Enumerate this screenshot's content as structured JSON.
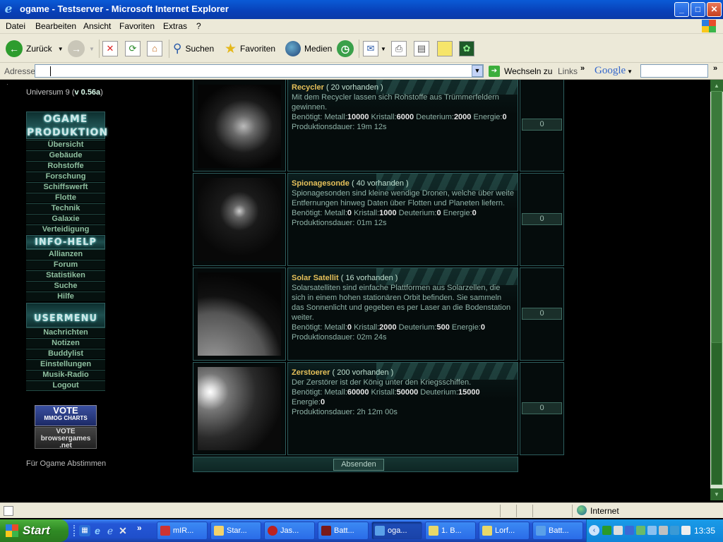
{
  "window": {
    "title": "ogame - Testserver - Microsoft Internet Explorer",
    "minimize": "_",
    "maximize": "□",
    "close": "✕"
  },
  "menu": [
    "Datei",
    "Bearbeiten",
    "Ansicht",
    "Favoriten",
    "Extras",
    "?"
  ],
  "toolbar": {
    "back_label": "Zurück",
    "search_label": "Suchen",
    "favorites_label": "Favoriten",
    "media_label": "Medien"
  },
  "address": {
    "label": "Adresse",
    "value": "",
    "go_label": "Wechseln zu",
    "links_label": "Links",
    "google_label": "Google"
  },
  "nav": {
    "universe_prefix": "Universum 9 (",
    "version": "v 0.56a",
    "universe_suffix": ")",
    "header_production": "OGAME PRODUKTION",
    "production_items": [
      "Übersicht",
      "Gebäude",
      "Rohstoffe",
      "Forschung",
      "Schiffswerft",
      "Flotte",
      "Technik",
      "Galaxie",
      "Verteidigung"
    ],
    "header_info": "INFO-HELP",
    "info_items": [
      "Allianzen",
      "Forum",
      "Statistiken",
      "Suche",
      "Hilfe"
    ],
    "header_user": "USERMENU",
    "user_items": [
      "Nachrichten",
      "Notizen",
      "Buddylist",
      "Einstellungen",
      "Musik-Radio",
      "Logout"
    ],
    "vote1_title": "VOTE",
    "vote1_sub": "MMOG CHARTS",
    "vote2_title": "VOTE",
    "vote2_sub1": "browsergames",
    "vote2_sub2": ".net",
    "vote_caption": "Für Ogame Abstimmen"
  },
  "ships": [
    {
      "name": "Recycler",
      "count": "( 20 vorhanden )",
      "description": "Mit dem Recycler lassen sich Rohstoffe aus Trümmerfeldern gewinnen.",
      "cost_prefix": "Benötigt: Metall:",
      "metal": "10000",
      "crystal_label": "Kristall:",
      "crystal": "6000",
      "deut_label": "Deuterium:",
      "deuterium": "2000",
      "energy_label": "Energie:",
      "energy": "0",
      "time": "Produktionsdauer: 19m 12s",
      "quantity": "0"
    },
    {
      "name": "Spionagesonde",
      "count": "( 40 vorhanden )",
      "description": "Spionagesonden sind kleine wendige Dronen, welche über weite Entfernungen hinweg Daten über Flotten und Planeten liefern.",
      "cost_prefix": "Benötigt: Metall:",
      "metal": "0",
      "crystal_label": "Kristall:",
      "crystal": "1000",
      "deut_label": "Deuterium:",
      "deuterium": "0",
      "energy_label": "Energie:",
      "energy": "0",
      "time": "Produktionsdauer: 01m 12s",
      "quantity": "0"
    },
    {
      "name": "Solar Satellit",
      "count": "( 16 vorhanden )",
      "description": "Solarsatelliten sind einfache Plattformen aus Solarzellen, die sich in einem hohen stationären Orbit befinden. Sie sammeln das Sonnenlicht und gegeben es per Laser an die Bodenstation weiter.",
      "cost_prefix": "Benötigt: Metall:",
      "metal": "0",
      "crystal_label": "Kristall:",
      "crystal": "2000",
      "deut_label": "Deuterium:",
      "deuterium": "500",
      "energy_label": "Energie:",
      "energy": "0",
      "time": "Produktionsdauer: 02m 24s",
      "quantity": "0"
    },
    {
      "name": "Zerstoerer",
      "count": "( 200 vorhanden )",
      "description": "Der Zerstörer ist der König unter den Kriegsschiffen.",
      "cost_prefix": "Benötigt: Metall:",
      "metal": "60000",
      "crystal_label": "Kristall:",
      "crystal": "50000",
      "deut_label": "Deuterium:",
      "deuterium": "15000",
      "energy_label": "Energie:",
      "energy": "0",
      "time": "Produktionsdauer: 2h 12m 00s",
      "quantity": "0"
    }
  ],
  "submit_label": "Absenden",
  "status": {
    "zone": "Internet"
  },
  "taskbar": {
    "start": "Start",
    "tasks": [
      "mIR...",
      "Star...",
      "Jas...",
      "Batt...",
      "oga...",
      "1. B...",
      "Lorf...",
      "Batt..."
    ],
    "clock": "13:35"
  },
  "colors": {
    "accent_gold": "#e6c15a",
    "nav_text": "#8fc0a0",
    "panel_border": "#2e5e5e",
    "xp_blue": "#0a5bd6"
  }
}
